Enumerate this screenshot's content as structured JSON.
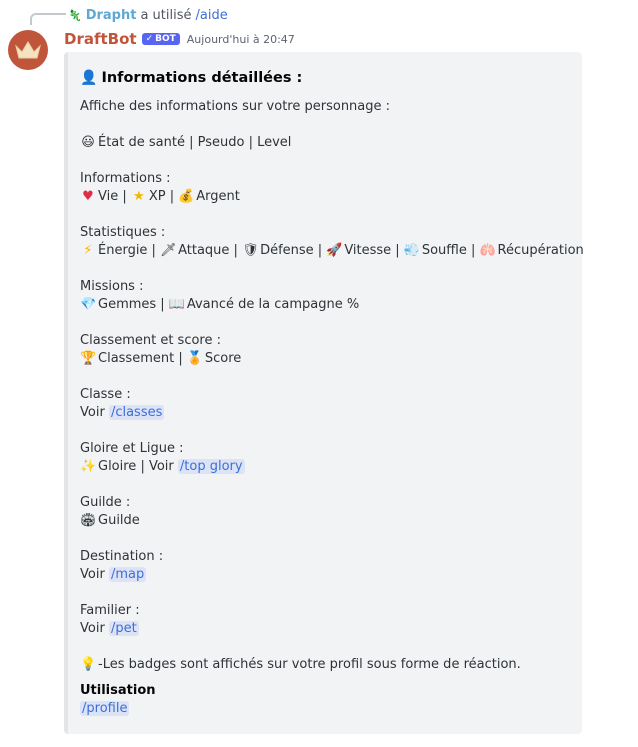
{
  "reply": {
    "user": "Drapht",
    "text": "a utilisé",
    "command": "/aide"
  },
  "message": {
    "username": "DraftBot",
    "badge": "BOT",
    "timestamp": "Aujourd'hui à 20:47"
  },
  "embed": {
    "title": "Informations détaillées :",
    "intro": "Affiche des informations sur votre personnage :",
    "state_line": "État de santé | Pseudo | Level",
    "informations": {
      "header": "Informations :",
      "vie": "Vie |",
      "xp": "XP |",
      "argent": "Argent"
    },
    "statistiques": {
      "header": "Statistiques :",
      "energie": "Énergie |",
      "attaque": "Attaque |",
      "defense": "Défense |",
      "vitesse": "Vitesse |",
      "souffle": "Souffle |",
      "recuperation": "Récupération"
    },
    "missions": {
      "header": "Missions :",
      "gemmes": "Gemmes |",
      "avance": "Avancé de la campagne %"
    },
    "classement": {
      "header": "Classement et score :",
      "classement": "Classement |",
      "score": "Score"
    },
    "classe": {
      "header": "Classe :",
      "voir": "Voir",
      "command": "/classes"
    },
    "gloire": {
      "header": "Gloire et Ligue :",
      "text": "Gloire | Voir",
      "command": "/top glory"
    },
    "guilde": {
      "header": "Guilde :",
      "text": "Guilde"
    },
    "destination": {
      "header": "Destination :",
      "voir": "Voir",
      "command": "/map"
    },
    "familier": {
      "header": "Familier :",
      "voir": "Voir",
      "command": "/pet"
    },
    "badges_note": "-Les badges sont affichés sur votre profil sous forme de réaction.",
    "utilisation": {
      "header": "Utilisation",
      "command": "/profile"
    }
  },
  "icons": {
    "title": "person-icon",
    "smiley": "smiley-icon",
    "heart": "heart-icon",
    "star": "star-icon",
    "moneybag": "money-bag-icon",
    "lightning": "lightning-icon",
    "dagger": "dagger-icon",
    "shield": "shield-icon",
    "rocket": "rocket-icon",
    "wind": "wind-icon",
    "lungs": "lungs-icon",
    "gem": "gem-icon",
    "book": "book-icon",
    "trophy": "trophy-icon",
    "medal": "medal-icon",
    "sparkles": "sparkles-icon",
    "stadium": "stadium-icon",
    "bulb": "bulb-icon"
  },
  "colors": {
    "username": "#c0553c",
    "link": "#3b6fd6",
    "bot_badge": "#5865f2"
  }
}
